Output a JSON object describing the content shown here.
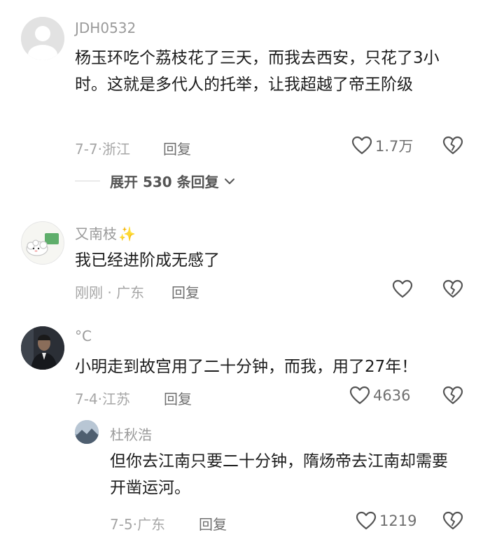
{
  "comments": [
    {
      "username": "JDH0532",
      "text": "杨玉环吃个荔枝花了三天，而我去西安，只花了3小时。这就是多代人的托举，让我超越了帝王阶级",
      "date": "7-7",
      "location": "浙江",
      "reply_label": "回复",
      "likes": "1.7万",
      "expand_label": "展开 530 条回复"
    },
    {
      "username": "又南枝",
      "username_emoji": "✨",
      "text": "我已经进阶成无感了",
      "date": "刚刚",
      "location": "广东",
      "reply_label": "回复",
      "likes": ""
    },
    {
      "username": "°C",
      "text": "小明走到故宫用了二十分钟，而我，用了27年！",
      "date": "7-4",
      "location": "江苏",
      "reply_label": "回复",
      "likes": "4636",
      "reply": {
        "username": "杜秋浩",
        "text": "但你去江南只要二十分钟，隋炀帝去江南却需要开凿运河。",
        "date": "7-5",
        "location": "广东",
        "reply_label": "回复",
        "likes": "1219"
      }
    }
  ],
  "colors": {
    "username": "#9a9a9a",
    "text": "#1c1c1c",
    "meta": "#a6a6a6",
    "icon": "#555555"
  },
  "icons": {
    "like": "heart-outline-icon",
    "dislike": "broken-heart-icon",
    "expand": "chevron-down-icon"
  }
}
